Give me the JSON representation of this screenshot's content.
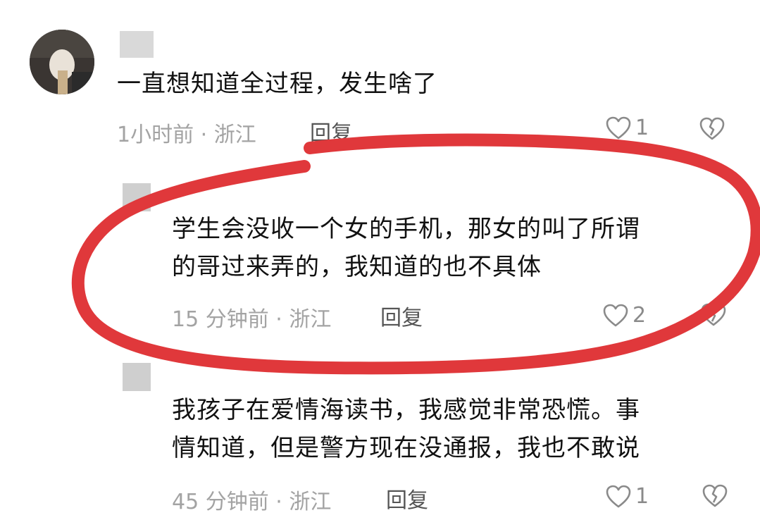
{
  "comments": [
    {
      "text_lines": [
        "一直想知道全过程，发生啥了"
      ],
      "time": "1小时前",
      "location": "浙江",
      "reply_label": "回复",
      "likes": "1"
    },
    {
      "text_lines": [
        "学生会没收一个女的手机，那女的叫了所谓",
        "的哥过来弄的，我知道的也不具体"
      ],
      "time": "15 分钟前",
      "location": "浙江",
      "reply_label": "回复",
      "likes": "2"
    },
    {
      "text_lines": [
        "我孩子在爱情海读书，我感觉非常恐慌。事",
        "情知道，但是警方现在没通报，我也不敢说"
      ],
      "time": "45 分钟前",
      "location": "浙江",
      "reply_label": "回复",
      "likes": "1"
    }
  ],
  "separator": "·",
  "colors": {
    "annotation": "#e0383b",
    "meta": "#a3a3a3"
  },
  "icons": {
    "like": "heart-outline-icon",
    "dislike": "broken-heart-icon"
  }
}
